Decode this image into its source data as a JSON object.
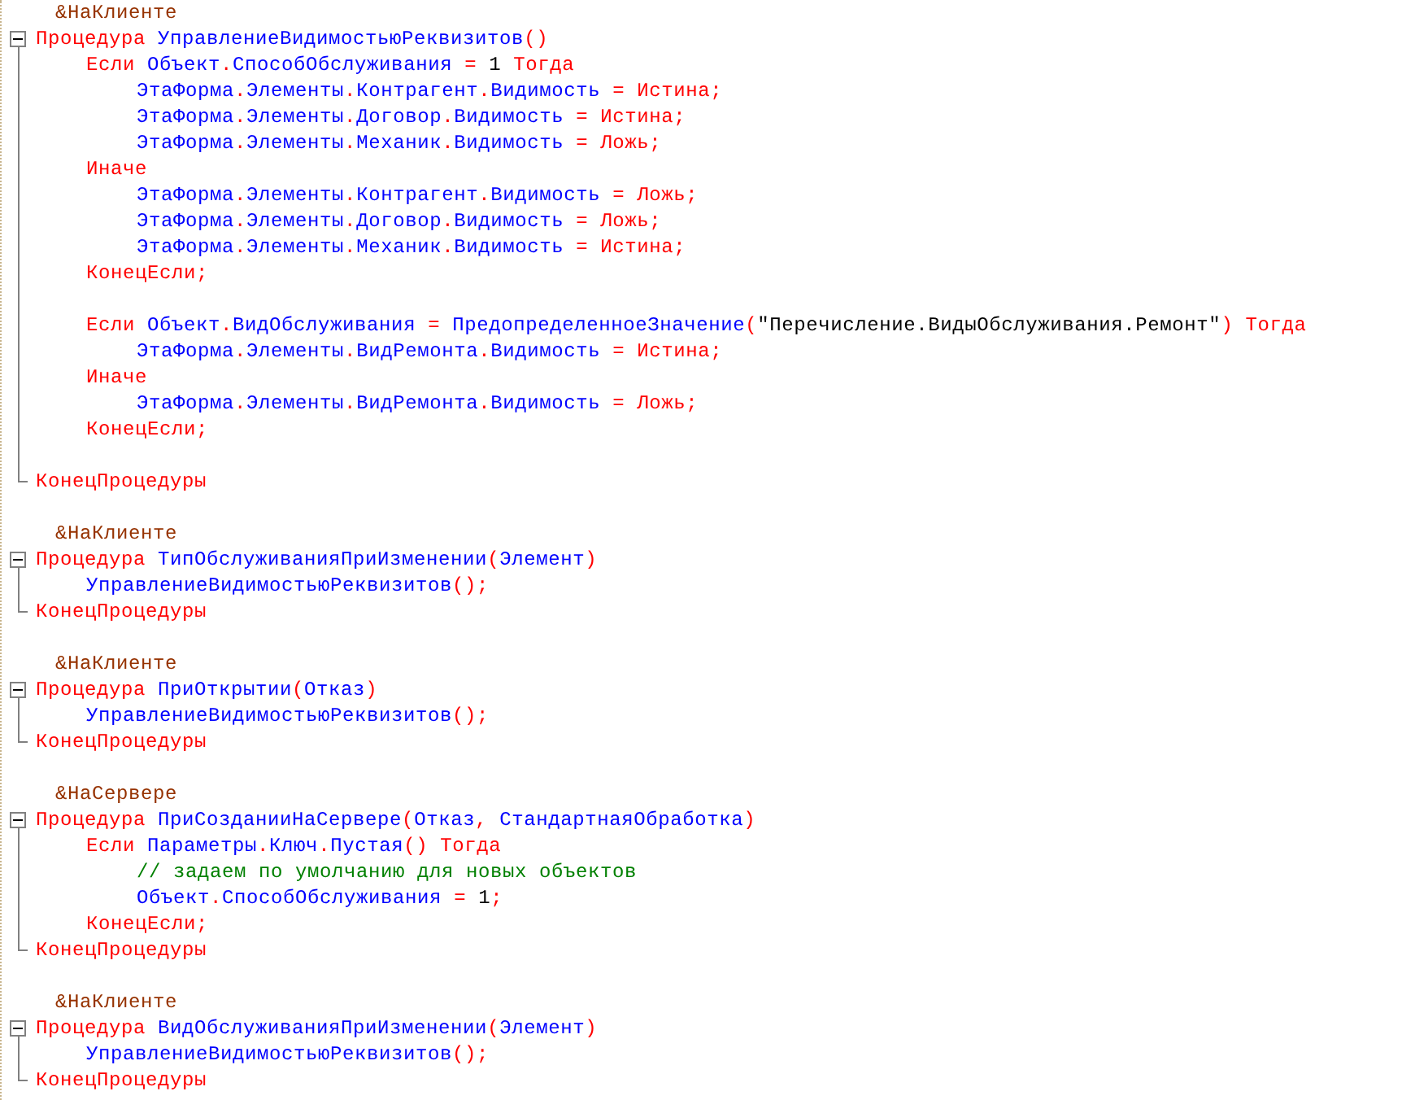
{
  "lines": [
    {
      "kind": "directive",
      "text": "&НаКлиенте"
    },
    {
      "kind": "code",
      "expanded": true,
      "tokens": [
        {
          "kind": "kw",
          "text": "Процедура "
        },
        {
          "kind": "id",
          "text": "УправлениеВидимостьюРеквизитов"
        },
        {
          "kind": "op",
          "text": "()"
        }
      ],
      "children": [
        {
          "kind": "code",
          "tokens": [
            {
              "kind": "kw",
              "text": "Если "
            },
            {
              "kind": "id",
              "text": "Объект"
            },
            {
              "kind": "op",
              "text": "."
            },
            {
              "kind": "id",
              "text": "СпособОбслуживания"
            },
            {
              "kind": "op",
              "text": " = "
            },
            {
              "kind": "num",
              "text": "1"
            },
            {
              "kind": "kw",
              "text": " Тогда"
            }
          ],
          "children": [
            {
              "kind": "code",
              "tokens": [
                {
                  "kind": "id",
                  "text": "ЭтаФорма"
                },
                {
                  "kind": "op",
                  "text": "."
                },
                {
                  "kind": "id",
                  "text": "Элементы"
                },
                {
                  "kind": "op",
                  "text": "."
                },
                {
                  "kind": "id",
                  "text": "Контрагент"
                },
                {
                  "kind": "op",
                  "text": "."
                },
                {
                  "kind": "id",
                  "text": "Видимость"
                },
                {
                  "kind": "op",
                  "text": " = "
                },
                {
                  "kind": "kw",
                  "text": "Истина"
                },
                {
                  "kind": "op",
                  "text": ";"
                }
              ]
            },
            {
              "kind": "code",
              "tokens": [
                {
                  "kind": "id",
                  "text": "ЭтаФорма"
                },
                {
                  "kind": "op",
                  "text": "."
                },
                {
                  "kind": "id",
                  "text": "Элементы"
                },
                {
                  "kind": "op",
                  "text": "."
                },
                {
                  "kind": "id",
                  "text": "Договор"
                },
                {
                  "kind": "op",
                  "text": "."
                },
                {
                  "kind": "id",
                  "text": "Видимость"
                },
                {
                  "kind": "op",
                  "text": " = "
                },
                {
                  "kind": "kw",
                  "text": "Истина"
                },
                {
                  "kind": "op",
                  "text": ";"
                }
              ]
            },
            {
              "kind": "code",
              "tokens": [
                {
                  "kind": "id",
                  "text": "ЭтаФорма"
                },
                {
                  "kind": "op",
                  "text": "."
                },
                {
                  "kind": "id",
                  "text": "Элементы"
                },
                {
                  "kind": "op",
                  "text": "."
                },
                {
                  "kind": "id",
                  "text": "Механик"
                },
                {
                  "kind": "op",
                  "text": "."
                },
                {
                  "kind": "id",
                  "text": "Видимость"
                },
                {
                  "kind": "op",
                  "text": " = "
                },
                {
                  "kind": "kw",
                  "text": "Ложь"
                },
                {
                  "kind": "op",
                  "text": ";"
                }
              ]
            }
          ]
        },
        {
          "kind": "code",
          "tokens": [
            {
              "kind": "kw",
              "text": "Иначе"
            }
          ],
          "children": [
            {
              "kind": "code",
              "tokens": [
                {
                  "kind": "id",
                  "text": "ЭтаФорма"
                },
                {
                  "kind": "op",
                  "text": "."
                },
                {
                  "kind": "id",
                  "text": "Элементы"
                },
                {
                  "kind": "op",
                  "text": "."
                },
                {
                  "kind": "id",
                  "text": "Контрагент"
                },
                {
                  "kind": "op",
                  "text": "."
                },
                {
                  "kind": "id",
                  "text": "Видимость"
                },
                {
                  "kind": "op",
                  "text": " = "
                },
                {
                  "kind": "kw",
                  "text": "Ложь"
                },
                {
                  "kind": "op",
                  "text": ";"
                }
              ]
            },
            {
              "kind": "code",
              "tokens": [
                {
                  "kind": "id",
                  "text": "ЭтаФорма"
                },
                {
                  "kind": "op",
                  "text": "."
                },
                {
                  "kind": "id",
                  "text": "Элементы"
                },
                {
                  "kind": "op",
                  "text": "."
                },
                {
                  "kind": "id",
                  "text": "Договор"
                },
                {
                  "kind": "op",
                  "text": "."
                },
                {
                  "kind": "id",
                  "text": "Видимость"
                },
                {
                  "kind": "op",
                  "text": " = "
                },
                {
                  "kind": "kw",
                  "text": "Ложь"
                },
                {
                  "kind": "op",
                  "text": ";"
                }
              ]
            },
            {
              "kind": "code",
              "tokens": [
                {
                  "kind": "id",
                  "text": "ЭтаФорма"
                },
                {
                  "kind": "op",
                  "text": "."
                },
                {
                  "kind": "id",
                  "text": "Элементы"
                },
                {
                  "kind": "op",
                  "text": "."
                },
                {
                  "kind": "id",
                  "text": "Механик"
                },
                {
                  "kind": "op",
                  "text": "."
                },
                {
                  "kind": "id",
                  "text": "Видимость"
                },
                {
                  "kind": "op",
                  "text": " = "
                },
                {
                  "kind": "kw",
                  "text": "Истина"
                },
                {
                  "kind": "op",
                  "text": ";"
                }
              ]
            }
          ]
        },
        {
          "kind": "code",
          "tokens": [
            {
              "kind": "kw",
              "text": "КонецЕсли"
            },
            {
              "kind": "op",
              "text": ";"
            }
          ]
        },
        {
          "kind": "blank"
        },
        {
          "kind": "code",
          "tokens": [
            {
              "kind": "kw",
              "text": "Если "
            },
            {
              "kind": "id",
              "text": "Объект"
            },
            {
              "kind": "op",
              "text": "."
            },
            {
              "kind": "id",
              "text": "ВидОбслуживания"
            },
            {
              "kind": "op",
              "text": " = "
            },
            {
              "kind": "id",
              "text": "ПредопределенноеЗначение"
            },
            {
              "kind": "op",
              "text": "("
            },
            {
              "kind": "str",
              "text": "\"Перечисление.ВидыОбслуживания.Ремонт\""
            },
            {
              "kind": "op",
              "text": ")"
            },
            {
              "kind": "kw",
              "text": " Тогда"
            }
          ],
          "children": [
            {
              "kind": "code",
              "tokens": [
                {
                  "kind": "id",
                  "text": "ЭтаФорма"
                },
                {
                  "kind": "op",
                  "text": "."
                },
                {
                  "kind": "id",
                  "text": "Элементы"
                },
                {
                  "kind": "op",
                  "text": "."
                },
                {
                  "kind": "id",
                  "text": "ВидРемонта"
                },
                {
                  "kind": "op",
                  "text": "."
                },
                {
                  "kind": "id",
                  "text": "Видимость"
                },
                {
                  "kind": "op",
                  "text": " = "
                },
                {
                  "kind": "kw",
                  "text": "Истина"
                },
                {
                  "kind": "op",
                  "text": ";"
                }
              ]
            }
          ]
        },
        {
          "kind": "code",
          "tokens": [
            {
              "kind": "kw",
              "text": "Иначе"
            }
          ],
          "children": [
            {
              "kind": "code",
              "tokens": [
                {
                  "kind": "id",
                  "text": "ЭтаФорма"
                },
                {
                  "kind": "op",
                  "text": "."
                },
                {
                  "kind": "id",
                  "text": "Элементы"
                },
                {
                  "kind": "op",
                  "text": "."
                },
                {
                  "kind": "id",
                  "text": "ВидРемонта"
                },
                {
                  "kind": "op",
                  "text": "."
                },
                {
                  "kind": "id",
                  "text": "Видимость"
                },
                {
                  "kind": "op",
                  "text": " = "
                },
                {
                  "kind": "kw",
                  "text": "Ложь"
                },
                {
                  "kind": "op",
                  "text": ";"
                }
              ]
            }
          ]
        },
        {
          "kind": "code",
          "tokens": [
            {
              "kind": "kw",
              "text": "КонецЕсли"
            },
            {
              "kind": "op",
              "text": ";"
            }
          ]
        },
        {
          "kind": "blank"
        }
      ]
    },
    {
      "kind": "code",
      "tokens": [
        {
          "kind": "kw",
          "text": "КонецПроцедуры"
        }
      ]
    },
    {
      "kind": "blank"
    },
    {
      "kind": "directive",
      "text": "&НаКлиенте"
    },
    {
      "kind": "code",
      "expanded": true,
      "tokens": [
        {
          "kind": "kw",
          "text": "Процедура "
        },
        {
          "kind": "id",
          "text": "ТипОбслуживанияПриИзменении"
        },
        {
          "kind": "op",
          "text": "("
        },
        {
          "kind": "id",
          "text": "Элемент"
        },
        {
          "kind": "op",
          "text": ")"
        }
      ],
      "children": [
        {
          "kind": "code",
          "tokens": [
            {
              "kind": "id",
              "text": "УправлениеВидимостьюРеквизитов"
            },
            {
              "kind": "op",
              "text": "();"
            }
          ]
        }
      ]
    },
    {
      "kind": "code",
      "tokens": [
        {
          "kind": "kw",
          "text": "КонецПроцедуры"
        }
      ]
    },
    {
      "kind": "blank"
    },
    {
      "kind": "directive",
      "text": "&НаКлиенте"
    },
    {
      "kind": "code",
      "expanded": true,
      "tokens": [
        {
          "kind": "kw",
          "text": "Процедура "
        },
        {
          "kind": "id",
          "text": "ПриОткрытии"
        },
        {
          "kind": "op",
          "text": "("
        },
        {
          "kind": "id",
          "text": "Отказ"
        },
        {
          "kind": "op",
          "text": ")"
        }
      ],
      "children": [
        {
          "kind": "code",
          "tokens": [
            {
              "kind": "id",
              "text": "УправлениеВидимостьюРеквизитов"
            },
            {
              "kind": "op",
              "text": "();"
            }
          ]
        }
      ]
    },
    {
      "kind": "code",
      "tokens": [
        {
          "kind": "kw",
          "text": "КонецПроцедуры"
        }
      ]
    },
    {
      "kind": "blank"
    },
    {
      "kind": "directive",
      "text": "&НаСервере"
    },
    {
      "kind": "code",
      "expanded": true,
      "tokens": [
        {
          "kind": "kw",
          "text": "Процедура "
        },
        {
          "kind": "id",
          "text": "ПриСозданииНаСервере"
        },
        {
          "kind": "op",
          "text": "("
        },
        {
          "kind": "id",
          "text": "Отказ"
        },
        {
          "kind": "op",
          "text": ", "
        },
        {
          "kind": "id",
          "text": "СтандартнаяОбработка"
        },
        {
          "kind": "op",
          "text": ")"
        }
      ],
      "children": [
        {
          "kind": "code",
          "tokens": [
            {
              "kind": "kw",
              "text": "Если "
            },
            {
              "kind": "id",
              "text": "Параметры"
            },
            {
              "kind": "op",
              "text": "."
            },
            {
              "kind": "id",
              "text": "Ключ"
            },
            {
              "kind": "op",
              "text": "."
            },
            {
              "kind": "id",
              "text": "Пустая"
            },
            {
              "kind": "op",
              "text": "()"
            },
            {
              "kind": "kw",
              "text": " Тогда"
            }
          ],
          "children": [
            {
              "kind": "comment",
              "text": "// задаем по умолчанию для новых объектов"
            },
            {
              "kind": "code",
              "tokens": [
                {
                  "kind": "id",
                  "text": "Объект"
                },
                {
                  "kind": "op",
                  "text": "."
                },
                {
                  "kind": "id",
                  "text": "СпособОбслуживания"
                },
                {
                  "kind": "op",
                  "text": " = "
                },
                {
                  "kind": "num",
                  "text": "1"
                },
                {
                  "kind": "op",
                  "text": ";"
                }
              ]
            }
          ]
        },
        {
          "kind": "code",
          "tokens": [
            {
              "kind": "kw",
              "text": "КонецЕсли"
            },
            {
              "kind": "op",
              "text": ";"
            }
          ]
        }
      ]
    },
    {
      "kind": "code",
      "tokens": [
        {
          "kind": "kw",
          "text": "КонецПроцедуры"
        }
      ]
    },
    {
      "kind": "blank"
    },
    {
      "kind": "directive",
      "text": "&НаКлиенте"
    },
    {
      "kind": "code",
      "expanded": true,
      "tokens": [
        {
          "kind": "kw",
          "text": "Процедура "
        },
        {
          "kind": "id",
          "text": "ВидОбслуживанияПриИзменении"
        },
        {
          "kind": "op",
          "text": "("
        },
        {
          "kind": "id",
          "text": "Элемент"
        },
        {
          "kind": "op",
          "text": ")"
        }
      ],
      "children": [
        {
          "kind": "code",
          "tokens": [
            {
              "kind": "id",
              "text": "УправлениеВидимостьюРеквизитов"
            },
            {
              "kind": "op",
              "text": "();"
            }
          ]
        }
      ]
    },
    {
      "kind": "code",
      "tokens": [
        {
          "kind": "kw",
          "text": "КонецПроцедуры"
        }
      ]
    }
  ]
}
